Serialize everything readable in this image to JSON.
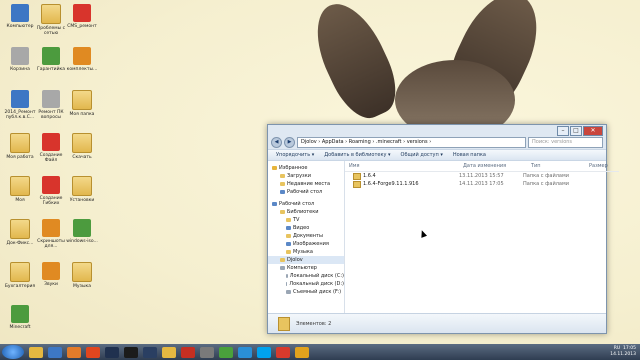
{
  "desktop": {
    "icons": [
      {
        "label": "Компьютер",
        "color": "app-blue"
      },
      {
        "label": "Проблемы с сетью",
        "color": "folder"
      },
      {
        "label": "CMS_ремонт",
        "color": "app-red"
      },
      {
        "label": "Корзина",
        "color": "app-gray"
      },
      {
        "label": "Гарантийка",
        "color": "app-green"
      },
      {
        "label": "комплекты...",
        "color": "app-orange"
      },
      {
        "label": "2014_Ремонт публ.к.в.С...",
        "color": "app-blue"
      },
      {
        "label": "Ремонт ПК вопросы",
        "color": "app-gray"
      },
      {
        "label": "Моя папка",
        "color": "folder"
      },
      {
        "label": "Моя работа",
        "color": "folder"
      },
      {
        "label": "Создание Файл",
        "color": "app-red"
      },
      {
        "label": "Скачать",
        "color": "folder"
      },
      {
        "label": "Моя",
        "color": "folder"
      },
      {
        "label": "Создание Гибких",
        "color": "app-red"
      },
      {
        "label": "Установки",
        "color": "folder"
      },
      {
        "label": "Док-Фикс...",
        "color": "folder"
      },
      {
        "label": "Скриншоты для...",
        "color": "app-orange"
      },
      {
        "label": "windows-iso...",
        "color": "app-green"
      },
      {
        "label": "Бухгалтерия",
        "color": "folder"
      },
      {
        "label": "Звуки",
        "color": "app-orange"
      },
      {
        "label": "Музыка",
        "color": "folder"
      },
      {
        "label": "Minecraft",
        "color": "app-green"
      }
    ]
  },
  "window": {
    "address": "Djolov  ›  AppData  ›  Roaming  ›  .minecraft  ›  versions  ›",
    "search_placeholder": "Поиск: versions",
    "toolbar": {
      "organize": "Упорядочить ▾",
      "add_library": "Добавить в библиотеку ▾",
      "share": "Общий доступ ▾",
      "new_folder": "Новая папка"
    },
    "nav": {
      "favorites": "Избранное",
      "downloads": "Загрузки",
      "recent": "Недавние места",
      "desktop_fav": "Рабочий стол",
      "desktop": "Рабочий стол",
      "libraries": "Библиотеки",
      "tv": "TV",
      "video": "Видео",
      "documents": "Документы",
      "images": "Изображения",
      "music": "Музыка",
      "user": "Djolov",
      "computer": "Компьютер",
      "disk_c": "Локальный диск (C:)",
      "disk_d": "Локальный диск (D:)",
      "removable": "Съемный диск (F:)"
    },
    "columns": {
      "name": "Имя",
      "date": "Дата изменения",
      "type": "Тип",
      "size": "Размер"
    },
    "files": [
      {
        "name": "1.6.4",
        "date": "13.11.2013 15:57",
        "type": "Папка с файлами"
      },
      {
        "name": "1.6.4-Forge9.11.1.916",
        "date": "14.11.2013 17:05",
        "type": "Папка с файлами"
      }
    ],
    "status": "Элементов: 2"
  },
  "taskbar": {
    "lang": "RU",
    "time": "17:05",
    "date": "14.11.2013"
  }
}
